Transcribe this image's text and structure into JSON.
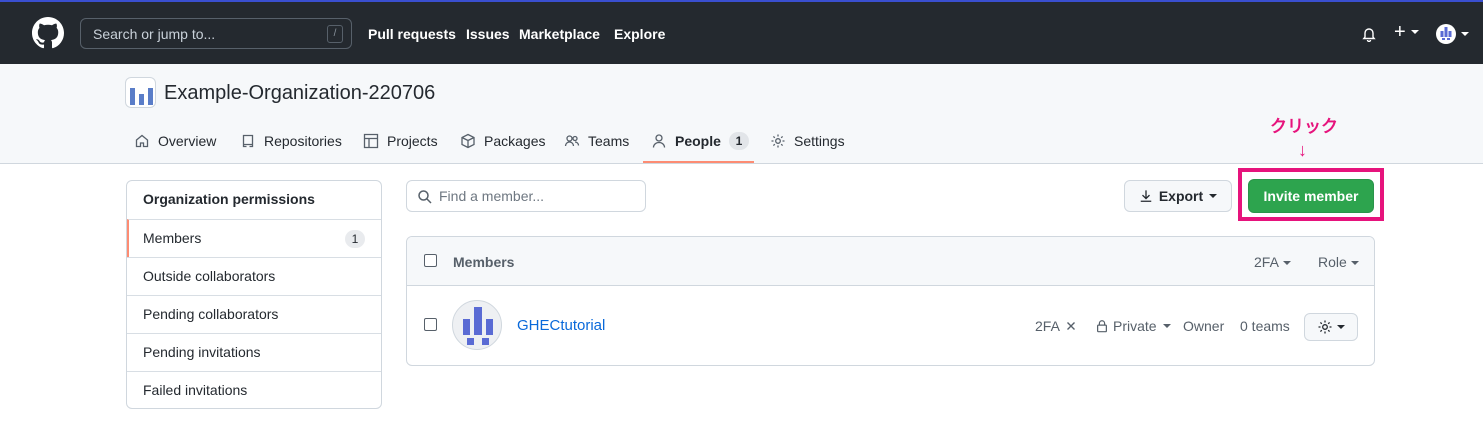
{
  "header": {
    "search_placeholder": "Search or jump to...",
    "search_shortcut": "/",
    "nav": [
      "Pull requests",
      "Issues",
      "Marketplace",
      "Explore"
    ],
    "plus_label": "+"
  },
  "org": {
    "name": "Example-Organization-220706",
    "tabs": [
      {
        "label": "Overview",
        "icon": "home-icon"
      },
      {
        "label": "Repositories",
        "icon": "repo-icon"
      },
      {
        "label": "Projects",
        "icon": "table-icon"
      },
      {
        "label": "Packages",
        "icon": "package-icon"
      },
      {
        "label": "Teams",
        "icon": "people-icon"
      },
      {
        "label": "People",
        "icon": "person-icon",
        "count": "1",
        "selected": true
      },
      {
        "label": "Settings",
        "icon": "gear-icon"
      }
    ]
  },
  "annotation": {
    "text": "クリック",
    "arrow": "↓",
    "color": "#e6137c"
  },
  "sidebar": {
    "items": [
      {
        "label": "Organization permissions"
      },
      {
        "label": "Members",
        "count": "1",
        "active": true
      },
      {
        "label": "Outside collaborators"
      },
      {
        "label": "Pending collaborators"
      },
      {
        "label": "Pending invitations"
      },
      {
        "label": "Failed invitations"
      }
    ]
  },
  "toolbar": {
    "find_placeholder": "Find a member...",
    "export_label": "Export",
    "invite_label": "Invite member"
  },
  "table": {
    "header_label": "Members",
    "filter_2fa": "2FA",
    "filter_role": "Role",
    "rows": [
      {
        "username": "GHECtutorial",
        "twofa": "2FA",
        "visibility": "Private",
        "role": "Owner",
        "teams": "0 teams"
      }
    ]
  },
  "colors": {
    "header_bg": "#24292f",
    "accent_underline": "#fd8c73",
    "invite_green": "#2da44e",
    "link_blue": "#0969da"
  }
}
